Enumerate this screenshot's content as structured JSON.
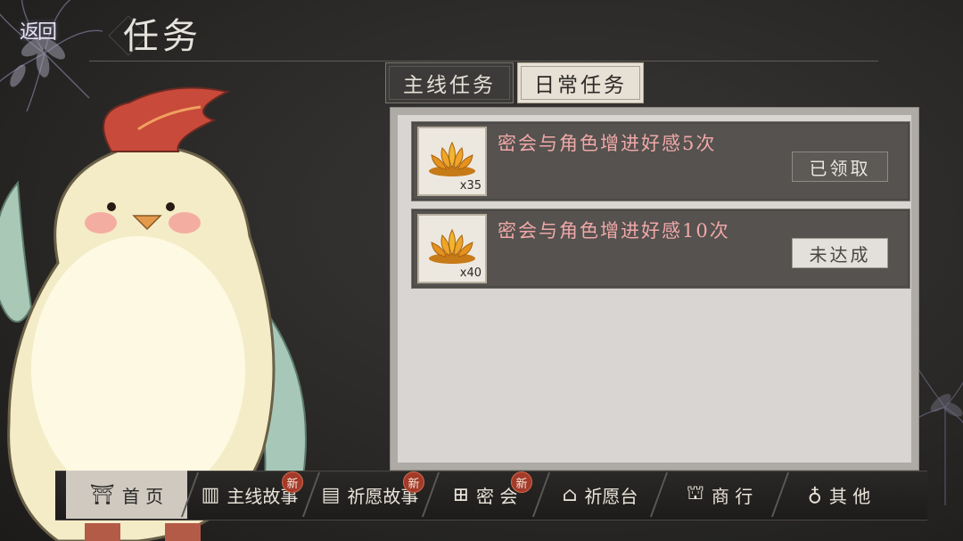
{
  "header": {
    "back_label": "返回",
    "title": "任务"
  },
  "tabs": [
    {
      "label": "主线任务",
      "selected": false
    },
    {
      "label": "日常任务",
      "selected": true
    }
  ],
  "tasks": [
    {
      "text": "密会与角色增进好感5次",
      "reward_icon": "lotus-icon",
      "reward_count": "x35",
      "button": "已领取",
      "status": "claimed"
    },
    {
      "text": "密会与角色增进好感10次",
      "reward_icon": "lotus-icon",
      "reward_count": "x40",
      "button": "未达成",
      "status": "unmet"
    }
  ],
  "nav": [
    {
      "label": "首 页",
      "icon": "home-icon",
      "badge": ""
    },
    {
      "label": "主线故事",
      "icon": "book-icon",
      "badge": "新"
    },
    {
      "label": "祈愿故事",
      "icon": "scroll-icon",
      "badge": "新"
    },
    {
      "label": "密 会",
      "icon": "meeting-icon",
      "badge": "新"
    },
    {
      "label": "祈愿台",
      "icon": "pavilion-icon",
      "badge": ""
    },
    {
      "label": "商 行",
      "icon": "shop-icon",
      "badge": ""
    },
    {
      "label": "其 他",
      "icon": "bag-icon",
      "badge": ""
    }
  ],
  "colors": {
    "task_text": "#f0a8a8",
    "badge": "#a33a2a",
    "panel": "#d6d4d2"
  }
}
